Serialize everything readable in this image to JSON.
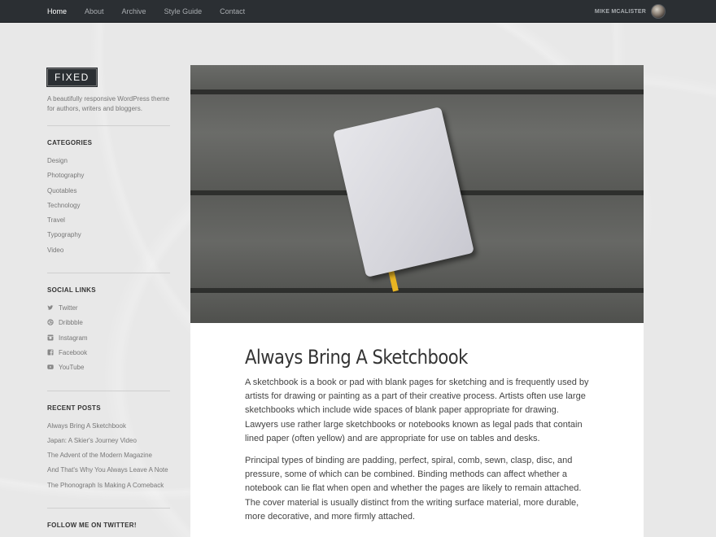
{
  "nav": {
    "items": [
      {
        "label": "Home",
        "active": true
      },
      {
        "label": "About"
      },
      {
        "label": "Archive"
      },
      {
        "label": "Style Guide"
      },
      {
        "label": "Contact"
      }
    ],
    "user_name": "MIKE MCALISTER"
  },
  "sidebar": {
    "logo": "FIXED",
    "tagline": "A beautifully responsive WordPress theme for authors, writers and bloggers.",
    "categories": {
      "title": "CATEGORIES",
      "items": [
        "Design",
        "Photography",
        "Quotables",
        "Technology",
        "Travel",
        "Typography",
        "Video"
      ]
    },
    "social": {
      "title": "SOCIAL LINKS",
      "items": [
        {
          "label": "Twitter",
          "icon": "twitter-icon"
        },
        {
          "label": "Dribbble",
          "icon": "dribbble-icon"
        },
        {
          "label": "Instagram",
          "icon": "instagram-icon"
        },
        {
          "label": "Facebook",
          "icon": "facebook-icon"
        },
        {
          "label": "YouTube",
          "icon": "youtube-icon"
        }
      ]
    },
    "recent": {
      "title": "RECENT POSTS",
      "items": [
        "Always Bring A Sketchbook",
        "Japan: A Skier's Journey Video",
        "The Advent of the Modern Magazine",
        "And That's Why You Always Leave A Note",
        "The Phonograph Is Making A Comeback"
      ]
    },
    "twitter_title": "FOLLOW ME ON TWITTER!"
  },
  "post": {
    "title": "Always Bring A Sketchbook",
    "paragraphs": [
      "A sketchbook is a book or pad with blank pages for sketching and is frequently used by artists for drawing or painting as a part of their creative process. Artists often use large sketchbooks which include wide spaces of blank paper appropriate for drawing. Lawyers use rather large sketchbooks or notebooks known as legal pads that contain lined paper (often yellow) and are appropriate for use on tables and desks.",
      "Principal types of binding are padding, perfect, spiral, comb, sewn, clasp, disc, and pressure, some of which can be combined. Binding methods can affect whether a notebook can lie flat when open and whether the pages are likely to remain attached. The cover material is usually distinct from the writing surface material, more durable, more decorative, and more firmly attached."
    ]
  },
  "colors": {
    "topbar": "#2b2f33",
    "page_bg": "#e8e8e8",
    "ribbon": "#e8b422"
  }
}
